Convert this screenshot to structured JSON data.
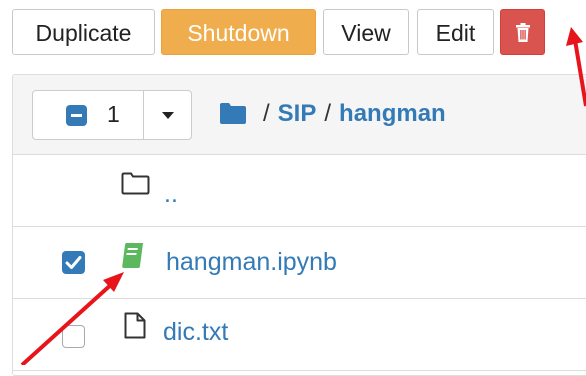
{
  "toolbar": {
    "duplicate_label": "Duplicate",
    "shutdown_label": "Shutdown",
    "view_label": "View",
    "edit_label": "Edit",
    "delete_icon": "trash-icon"
  },
  "header": {
    "selected_count": "1",
    "breadcrumb": {
      "root_icon": "folder-icon",
      "separator": "/",
      "items": [
        "SIP",
        "hangman"
      ]
    }
  },
  "files": [
    {
      "name": "..",
      "icon": "folder-icon",
      "checked": false,
      "show_checkbox": false
    },
    {
      "name": "hangman.ipynb",
      "icon": "notebook-icon",
      "checked": true,
      "show_checkbox": true
    },
    {
      "name": "dic.txt",
      "icon": "file-icon",
      "checked": false,
      "show_checkbox": true
    }
  ],
  "colors": {
    "shutdown": "#f0ad4e",
    "delete": "#d9534f",
    "link": "#337ab7",
    "running_notebook": "#5cb85c",
    "annotation_arrow": "#e8141b"
  }
}
